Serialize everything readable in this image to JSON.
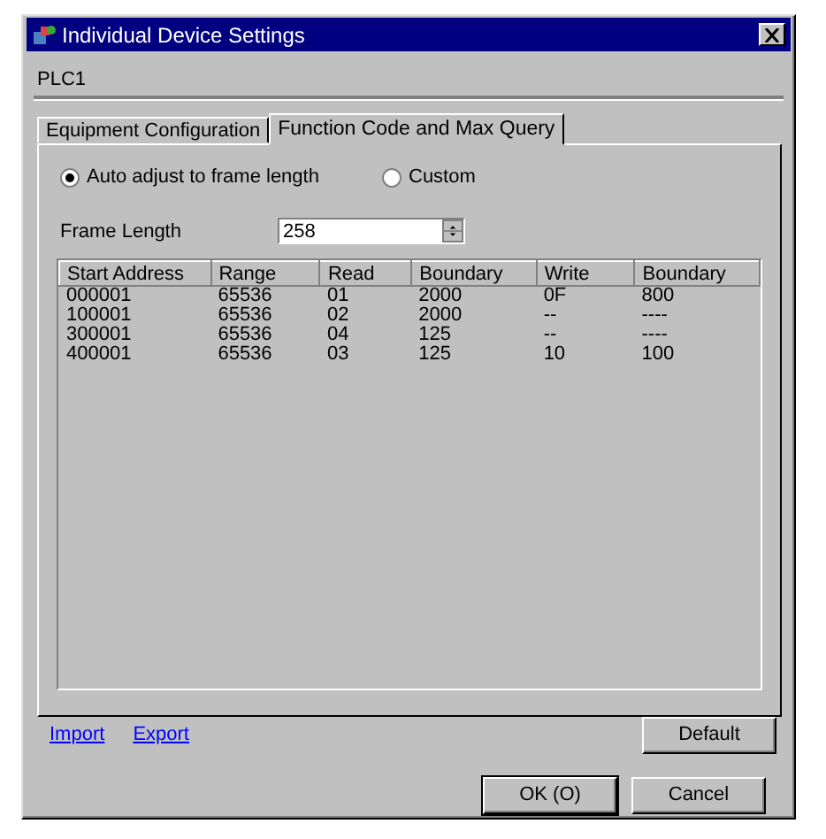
{
  "window": {
    "title": "Individual Device Settings"
  },
  "device": "PLC1",
  "tabs": [
    {
      "label": "Equipment Configuration",
      "selected": false
    },
    {
      "label": "Function Code and Max Query",
      "selected": true
    }
  ],
  "mode": [
    {
      "label": "Auto adjust to frame length",
      "selected": true
    },
    {
      "label": "Custom",
      "selected": false
    }
  ],
  "frame_length": {
    "label": "Frame Length",
    "value": "258"
  },
  "table": {
    "columns": [
      "Start Address",
      "Range",
      "Read",
      "Boundary",
      "Write",
      "Boundary"
    ],
    "rows": [
      [
        "000001",
        "65536",
        "01",
        "2000",
        "0F",
        "800"
      ],
      [
        "100001",
        "65536",
        "02",
        "2000",
        "--",
        "----"
      ],
      [
        "300001",
        "65536",
        "04",
        "125",
        "--",
        "----"
      ],
      [
        "400001",
        "65536",
        "03",
        "125",
        "10",
        "100"
      ]
    ]
  },
  "links": [
    "Import",
    "Export"
  ],
  "default_button": "Default",
  "buttons": [
    "OK (O)",
    "Cancel"
  ]
}
